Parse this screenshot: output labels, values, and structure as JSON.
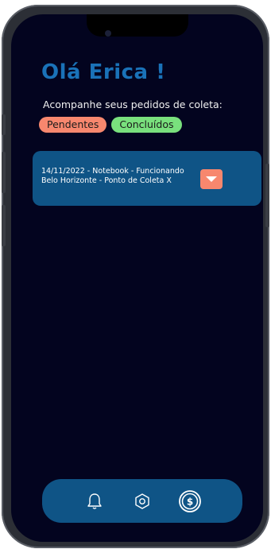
{
  "greeting": "Olá Erica !",
  "subtitle": "Acompanhe seus pedidos de coleta:",
  "filters": {
    "pending_label": "Pendentes",
    "done_label": "Concluídos"
  },
  "orders": [
    {
      "line1": "14/11/2022 - Notebook - Funcionando",
      "line2": "Belo Horizonte - Ponto de Coleta X"
    }
  ],
  "icons": {
    "expand": "chevron-down-icon",
    "nav": [
      "bell-icon",
      "settings-icon",
      "dollar-icon"
    ]
  },
  "colors": {
    "background": "#03041f",
    "primary": "#0f5486",
    "greeting": "#1a72b8",
    "pending": "#f7876e",
    "done": "#79e07d"
  }
}
